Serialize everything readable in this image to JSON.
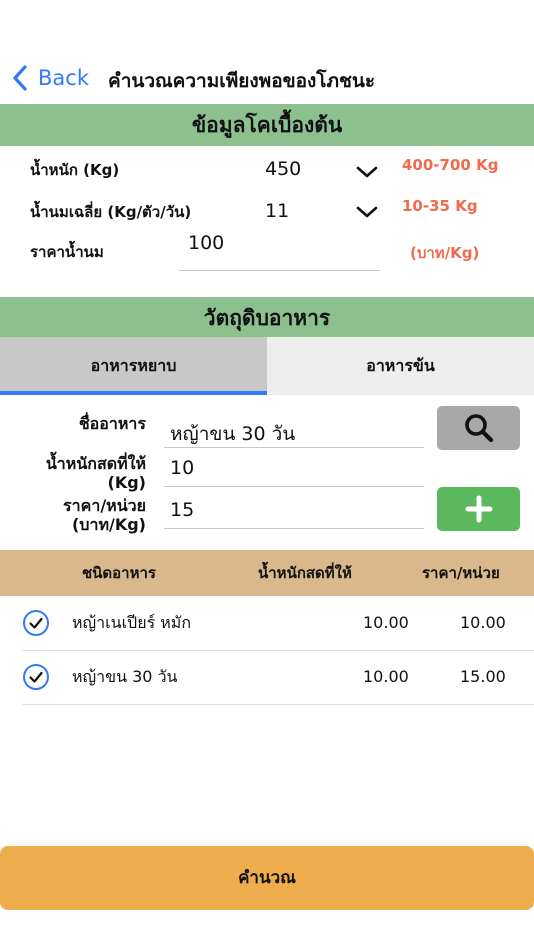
{
  "nav": {
    "back_label": "Back",
    "title": "คำนวณความเพียงพอของโภชนะ"
  },
  "basic": {
    "header": "ข้อมูลโคเบื้องต้น",
    "weight": {
      "label": "น้ำหนัก (Kg)",
      "value": "450",
      "range": "400-700 Kg"
    },
    "milk": {
      "label": "น้ำนมเฉลี่ย (Kg/ตัว/วัน)",
      "value": "11",
      "range": "10-35 Kg"
    },
    "price": {
      "label": "ราคาน้ำนม",
      "value": "100",
      "unit": "(บาท/Kg)"
    }
  },
  "feed": {
    "header": "วัตถุดิบอาหาร",
    "tabs": [
      "อาหารหยาบ",
      "อาหารข้น"
    ],
    "form": {
      "name_label": "ชื่ออาหาร",
      "name_value": "หญ้าขน 30 วัน",
      "weight_label_1": "น้ำหนักสดที่ให้",
      "weight_label_2": "(Kg)",
      "weight_value": "10",
      "price_label_1": "ราคา/หน่วย",
      "price_label_2": "(บาท/Kg)",
      "price_value": "15"
    }
  },
  "table": {
    "columns": [
      "ชนิดอาหาร",
      "น้ำหนักสดที่ให้",
      "ราคา/หน่วย"
    ],
    "rows": [
      {
        "name": "หญ้าเนเปียร์ หมัก",
        "weight": "10.00",
        "price": "10.00"
      },
      {
        "name": "หญ้าขน 30 วัน",
        "weight": "10.00",
        "price": "15.00"
      }
    ]
  },
  "calculate_label": "คำนวณ",
  "colors": {
    "accent": "#2f7cf6",
    "section": "#8cc08f",
    "range": "#f06a4b",
    "table_head": "#d9b88c",
    "calc": "#f0ad4e",
    "add": "#5cb85c"
  }
}
